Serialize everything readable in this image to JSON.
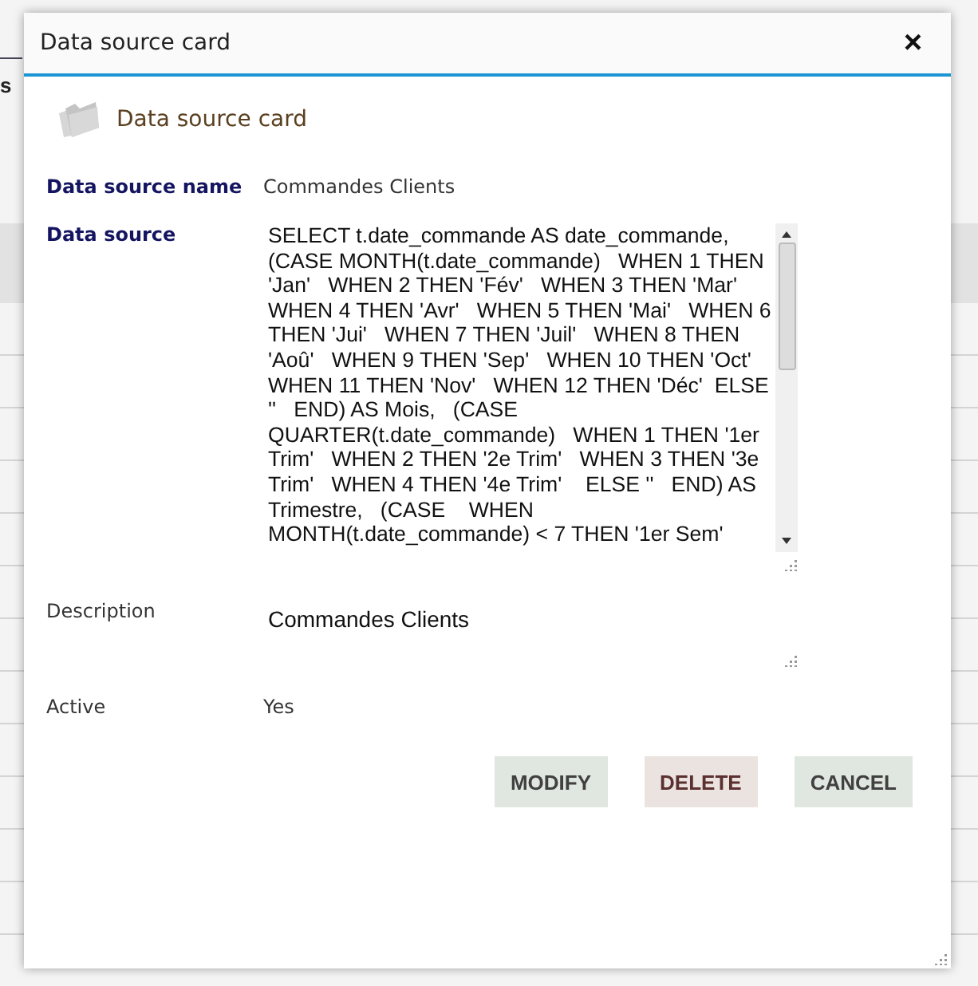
{
  "background": {
    "column_fragment": "s"
  },
  "window": {
    "title": "Data source card",
    "close": "×"
  },
  "header": {
    "title": "Data source card"
  },
  "fields": [
    {
      "kind": "text",
      "label": "Data source name",
      "emphasized": true,
      "value": "Commandes Clients"
    },
    {
      "kind": "code",
      "label": "Data source",
      "emphasized": true,
      "value": "SELECT t.date_commande AS date_commande,   (CASE MONTH(t.date_commande)   WHEN 1 THEN 'Jan'   WHEN 2 THEN 'Fév'   WHEN 3 THEN 'Mar'   WHEN 4 THEN 'Avr'   WHEN 5 THEN 'Mai'   WHEN 6 THEN 'Jui'   WHEN 7 THEN 'Juil'   WHEN 8 THEN 'Aoû'   WHEN 9 THEN 'Sep'   WHEN 10 THEN 'Oct'   WHEN 11 THEN 'Nov'   WHEN 12 THEN 'Déc'  ELSE ''   END) AS Mois,   (CASE QUARTER(t.date_commande)   WHEN 1 THEN '1er Trim'   WHEN 2 THEN '2e Trim'   WHEN 3 THEN '3e Trim'   WHEN 4 THEN '4e Trim'    ELSE ''   END) AS Trimestre,   (CASE    WHEN MONTH(t.date_commande) < 7 THEN '1er Sem'"
    },
    {
      "kind": "area",
      "label": "Description",
      "emphasized": false,
      "value": "Commandes Clients"
    },
    {
      "kind": "text",
      "label": "Active",
      "emphasized": false,
      "value": "Yes"
    }
  ],
  "buttons": [
    {
      "label": "MODIFY",
      "kind": "neutral"
    },
    {
      "label": "DELETE",
      "kind": "danger"
    },
    {
      "label": "CANCEL",
      "kind": "neutral"
    }
  ]
}
